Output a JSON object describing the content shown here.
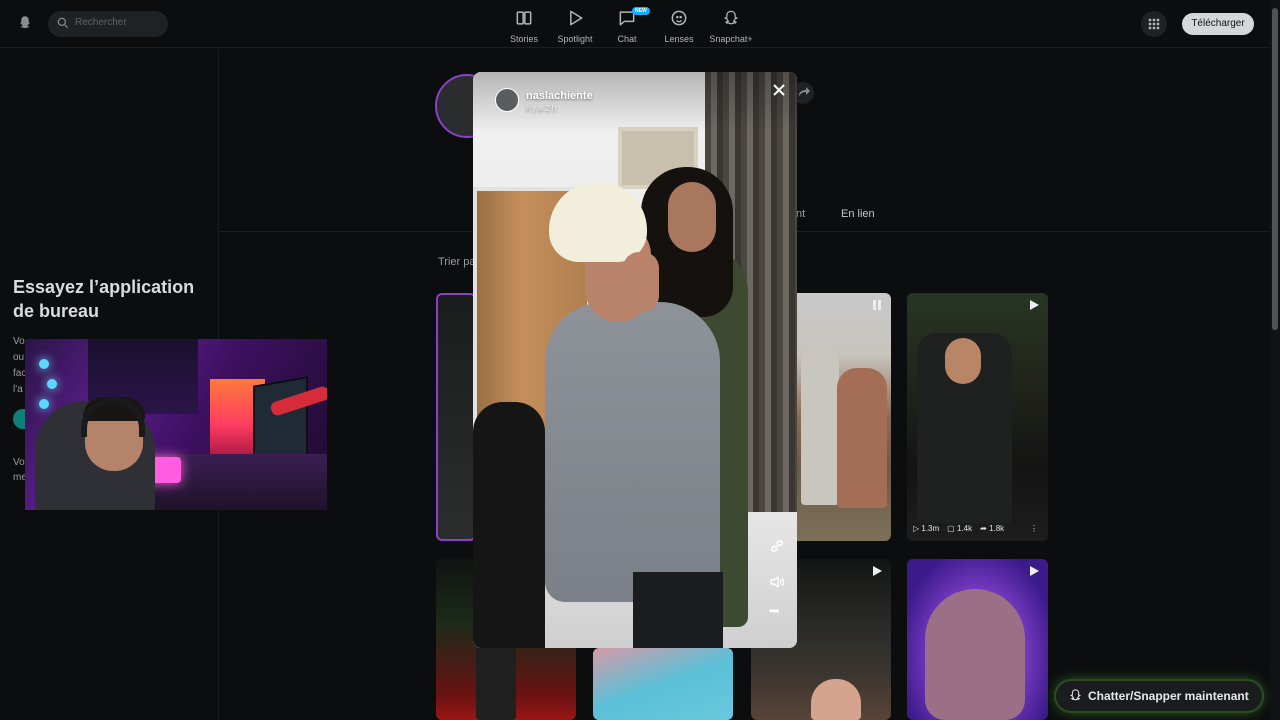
{
  "topbar": {
    "search_placeholder": "Rechercher",
    "nav": [
      {
        "label": "Stories",
        "icon": "stories-icon"
      },
      {
        "label": "Spotlight",
        "icon": "play-icon"
      },
      {
        "label": "Chat",
        "icon": "chat-icon",
        "badge": "NEW"
      },
      {
        "label": "Lenses",
        "icon": "lenses-icon"
      },
      {
        "label": "Snapchat+",
        "icon": "snapchat-plus-icon"
      }
    ],
    "download_label": "Télécharger"
  },
  "left_panel": {
    "title": "Essayez l’application de bureau",
    "text_fragments": [
      "Vo",
      "ou",
      "fac",
      "l'a"
    ],
    "text2_fragments": [
      "Vo",
      "me"
    ]
  },
  "profile": {
    "tabs": [
      {
        "label": "nt"
      },
      {
        "label": "En lien"
      }
    ],
    "sort_label": "Trier pa"
  },
  "tiles": {
    "t3_stats": {
      "plays": "1.3m",
      "comments": "1.4k",
      "shares": "1.8k"
    }
  },
  "story": {
    "username": "naslachiente",
    "timestamp": "Il y a 2 h"
  },
  "chat_button": {
    "label": "Chatter/Snapper maintenant"
  },
  "colors": {
    "accent_purple": "#8b40c9",
    "badge_blue": "#0fadff",
    "chat_glow": "#3b6b2a"
  }
}
